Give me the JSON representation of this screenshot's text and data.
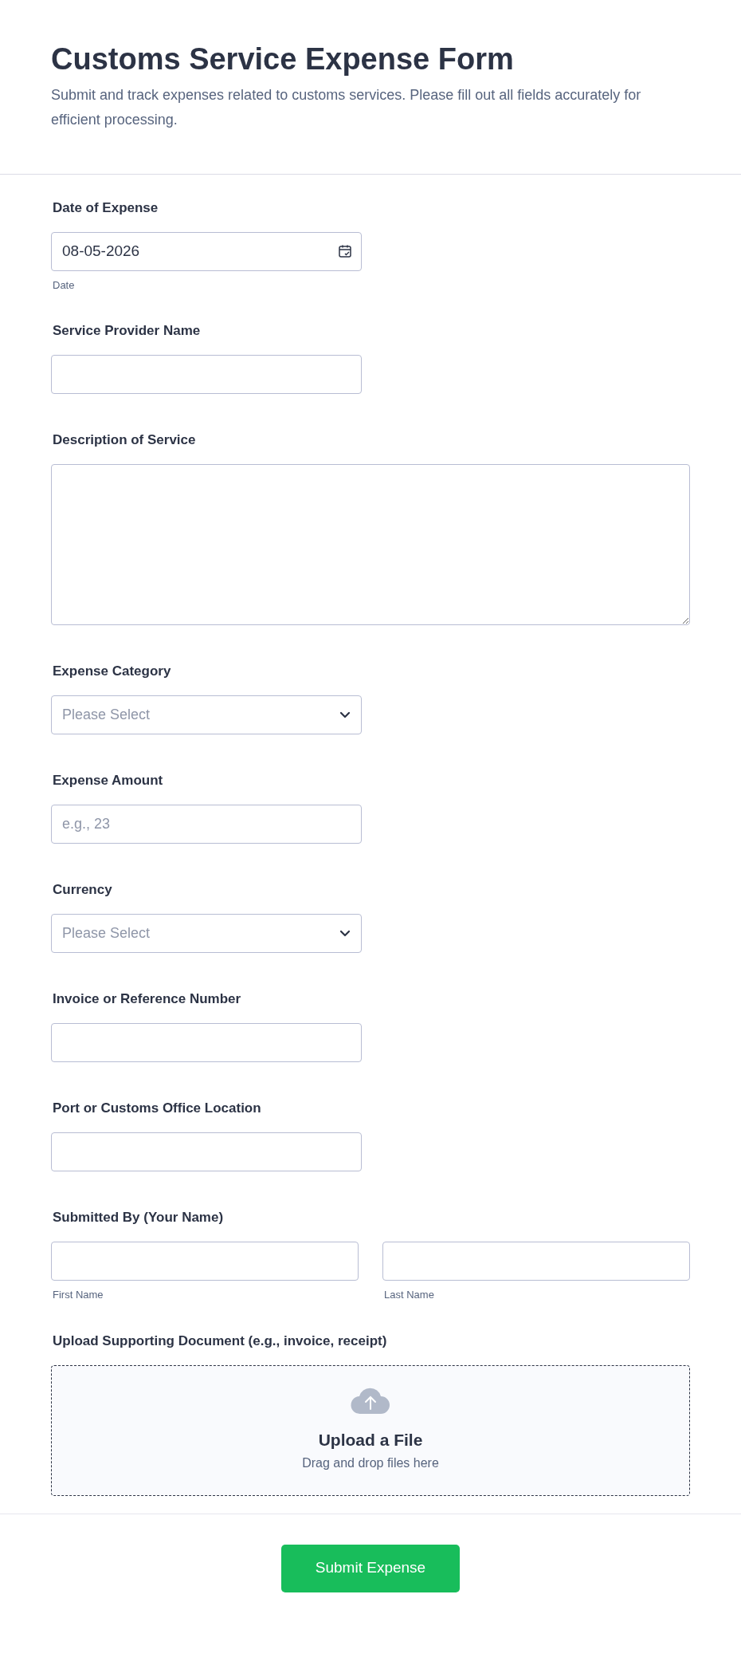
{
  "header": {
    "title": "Customs Service Expense Form",
    "description": "Submit and track expenses related to customs services. Please fill out all fields accurately for efficient processing."
  },
  "fields": [
    {
      "kind": "date",
      "label": "Date of Expense",
      "value": "08-05-2026",
      "sublabel": "Date"
    },
    {
      "kind": "text",
      "label": "Service Provider Name"
    },
    {
      "kind": "textarea",
      "label": "Description of Service"
    },
    {
      "kind": "select",
      "label": "Expense Category",
      "placeholder": "Please Select"
    },
    {
      "kind": "text",
      "label": "Expense Amount",
      "placeholder": "e.g., 23"
    },
    {
      "kind": "select",
      "label": "Currency",
      "placeholder": "Please Select"
    },
    {
      "kind": "text",
      "label": "Invoice or Reference Number"
    },
    {
      "kind": "text",
      "label": "Port or Customs Office Location"
    },
    {
      "kind": "name",
      "label": "Submitted By (Your Name)",
      "parts": [
        {
          "sublabel": "First Name"
        },
        {
          "sublabel": "Last Name"
        }
      ]
    },
    {
      "kind": "upload",
      "label": "Upload Supporting Document (e.g., invoice, receipt)",
      "title": "Upload a File",
      "hint": "Drag and drop files here"
    }
  ],
  "submit": {
    "label": "Submit Expense"
  }
}
